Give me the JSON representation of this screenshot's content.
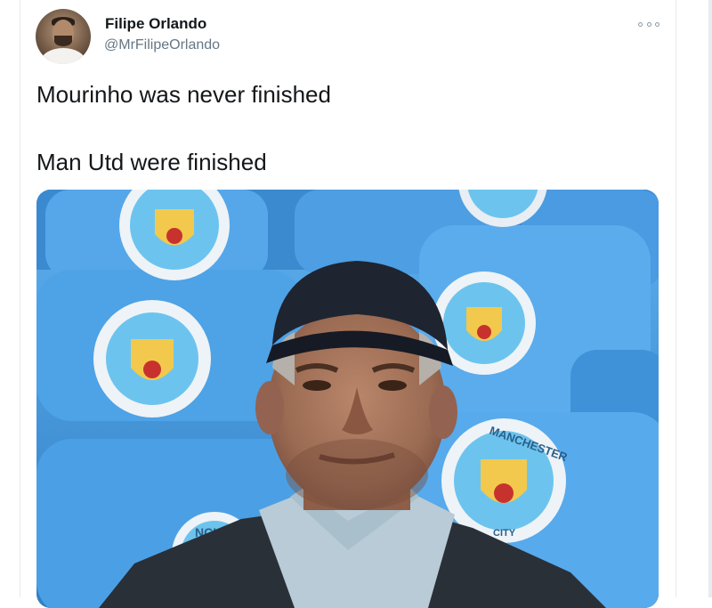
{
  "tweet": {
    "author": {
      "display_name": "Filipe Orlando",
      "handle": "@MrFilipeOrlando"
    },
    "text_lines": [
      "Mourinho was never finished",
      "Man Utd were finished"
    ],
    "more_icon": "more-horizontal-icon",
    "media": {
      "kind": "photo",
      "badge_text": [
        "MANCHESTER",
        "CITY",
        "NCH"
      ]
    }
  },
  "colors": {
    "name": "#14171a",
    "handle": "#657786",
    "border": "#e6ecf0",
    "seat_blue": "#3e8fd2"
  }
}
